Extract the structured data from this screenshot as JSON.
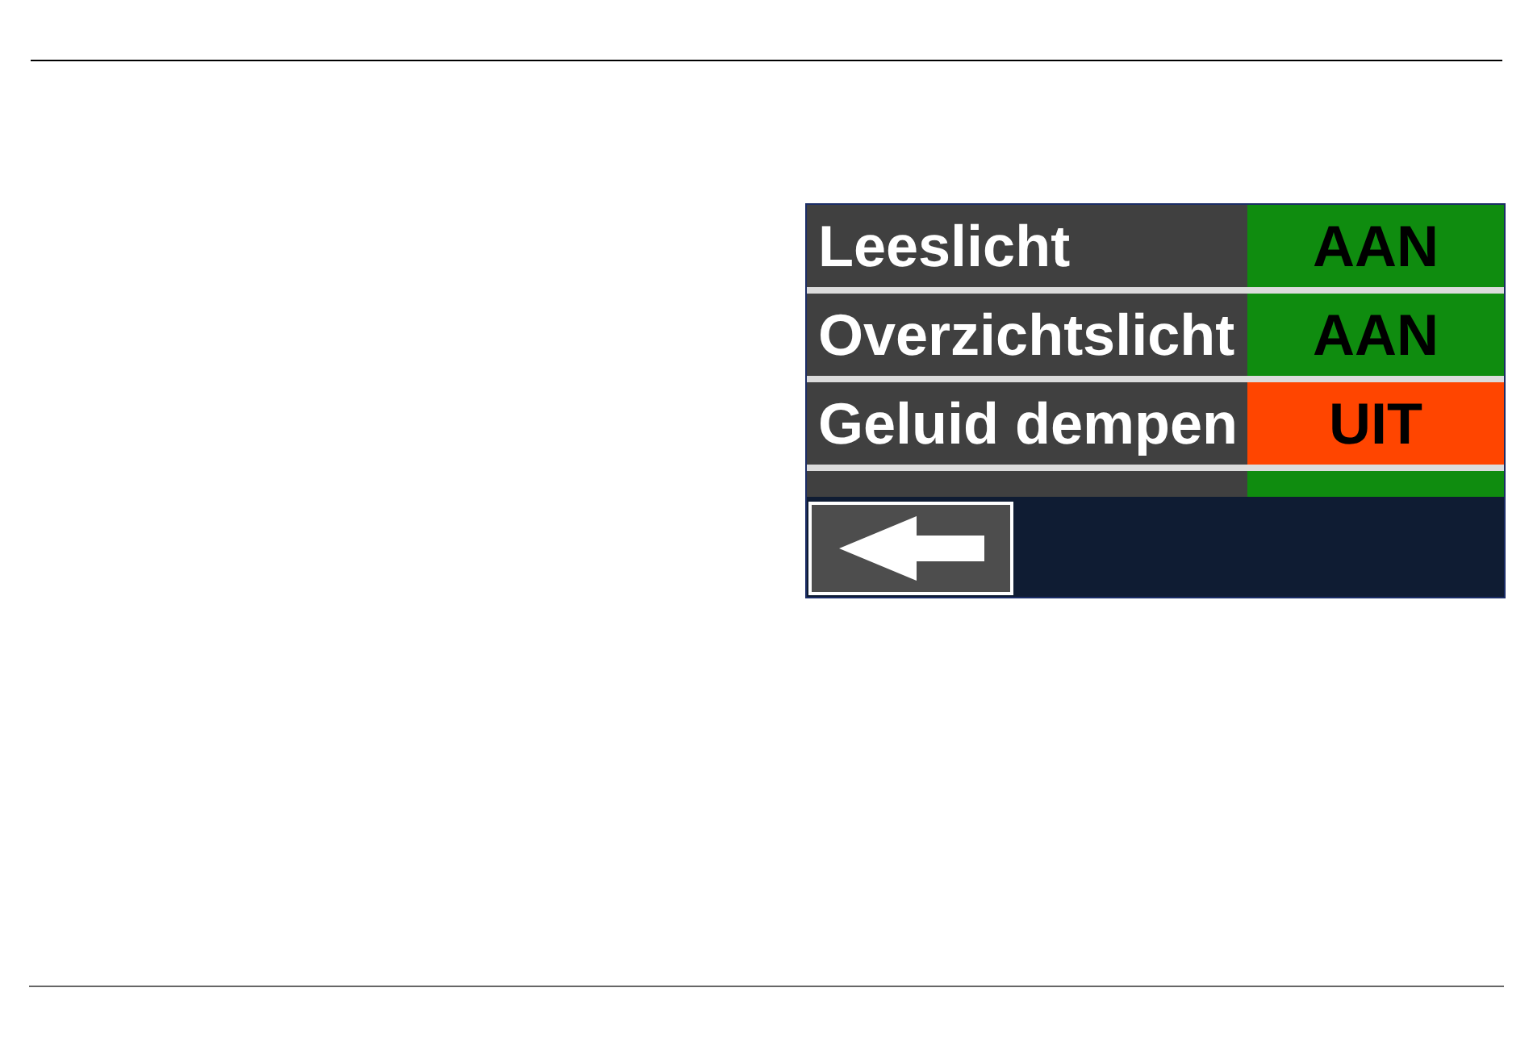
{
  "settings": {
    "rows": [
      {
        "label": "Leeslicht",
        "on": true,
        "value": "AAN"
      },
      {
        "label": "Overzichtslicht",
        "on": true,
        "value": "AAN"
      },
      {
        "label": "Geluid dempen",
        "on": false,
        "value": "UIT"
      },
      {
        "on": true
      }
    ]
  }
}
